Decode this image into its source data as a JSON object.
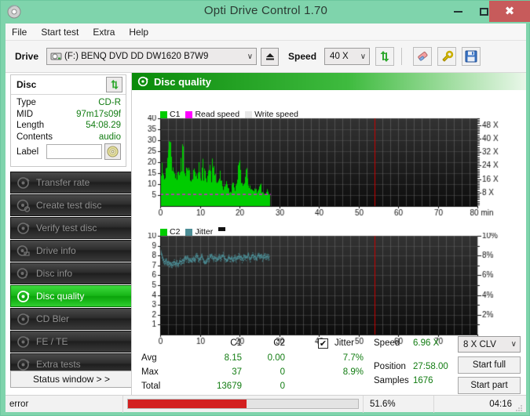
{
  "window": {
    "title": "Opti Drive Control 1.70",
    "icon": "disc-icon",
    "minimize_label": "–",
    "maximize_label": "□",
    "close_label": "×"
  },
  "menu": {
    "items": [
      "File",
      "Start test",
      "Extra",
      "Help"
    ]
  },
  "toolbar": {
    "drive_label": "Drive",
    "drive_value": "(F:)   BENQ DVD DD DW1620 B7W9",
    "eject_icon": "eject-icon",
    "speed_label": "Speed",
    "speed_value": "40 X",
    "refresh_icon": "refresh-icon",
    "eraser_icon": "eraser-icon",
    "tools_icon": "wrench-icon",
    "save_icon": "save-floppy-icon",
    "dropdown_arrow": "∨"
  },
  "disc": {
    "header": "Disc",
    "refresh_icon": "refresh-icon",
    "rows": [
      {
        "key": "Type",
        "value": "CD-R"
      },
      {
        "key": "MID",
        "value": "97m17s09f"
      },
      {
        "key": "Length",
        "value": "54:08.29"
      },
      {
        "key": "Contents",
        "value": "audio"
      }
    ],
    "label_key": "Label",
    "label_value": "",
    "label_placeholder": "",
    "label_icon": "cd-disc-icon"
  },
  "sidebar": {
    "items": [
      {
        "label": "Transfer rate",
        "icon": "disc-test-icon",
        "active": false
      },
      {
        "label": "Create test disc",
        "icon": "disc-create-icon",
        "active": false
      },
      {
        "label": "Verify test disc",
        "icon": "disc-verify-icon",
        "active": false
      },
      {
        "label": "Drive info",
        "icon": "disc-drive-icon",
        "active": false
      },
      {
        "label": "Disc info",
        "icon": "disc-info-icon",
        "active": false
      },
      {
        "label": "Disc quality",
        "icon": "disc-quality-icon",
        "active": true
      },
      {
        "label": "CD Bler",
        "icon": "disc-bler-icon",
        "active": false
      },
      {
        "label": "FE / TE",
        "icon": "disc-fete-icon",
        "active": false
      },
      {
        "label": "Extra tests",
        "icon": "disc-extra-icon",
        "active": false
      }
    ],
    "status_window_button": "Status window > >"
  },
  "panel": {
    "title": "Disc quality",
    "icon": "disc-quality-icon"
  },
  "stats": {
    "col_headers": [
      "C1",
      "C2"
    ],
    "jitter_header": "Jitter",
    "jitter_checked": true,
    "jitter_check_glyph": "✔",
    "rows": [
      {
        "name": "Avg",
        "c1": "8.15",
        "c2": "0.00",
        "jitter": "7.7%"
      },
      {
        "name": "Max",
        "c1": "37",
        "c2": "0",
        "jitter": "8.9%"
      },
      {
        "name": "Total",
        "c1": "13679",
        "c2": "0",
        "jitter": ""
      }
    ],
    "speed_label": "Speed",
    "speed_value": "6.96 X",
    "position_label": "Position",
    "position_value": "27:58.00",
    "samples_label": "Samples",
    "samples_value": "1676",
    "speed_select": "8 X CLV",
    "speed_select_arrow": "∨",
    "start_full": "Start full",
    "start_part": "Start part"
  },
  "statusbar": {
    "message": "error",
    "progress_percent": 51.6,
    "progress_text": "51.6%",
    "elapsed": "04:16"
  },
  "colors": {
    "accent_green": "#00c000",
    "title_bar": "#7fd4ac",
    "close_red": "#c75b5b",
    "c1_green": "#00cc00",
    "read_speed_magenta": "#ff00ff",
    "jitter_teal": "#4d8e96",
    "marker_red": "#cc0000",
    "progress_red": "#d32020",
    "plot_bg": "#1a1a1a"
  },
  "chart_data": [
    {
      "type": "bar",
      "title": "C1 errors / Read speed",
      "legend": [
        {
          "label": "C1",
          "color": "#00cc00"
        },
        {
          "label": "Read speed",
          "color": "#ff00ff"
        },
        {
          "label": "Write speed",
          "color": "#e8e8e8"
        }
      ],
      "legend_position": "top-left",
      "xlabel": "min",
      "ylabel": "",
      "y2label": "X",
      "xlim": [
        0,
        80
      ],
      "ylim": [
        0,
        40
      ],
      "y2lim": [
        0,
        52
      ],
      "xticks": [
        0,
        10,
        20,
        30,
        40,
        50,
        60,
        70,
        80
      ],
      "xticklabels": [
        "0",
        "10",
        "20",
        "30",
        "40",
        "50",
        "60",
        "70",
        "80 min"
      ],
      "yticks": [
        5,
        10,
        15,
        20,
        25,
        30,
        35,
        40
      ],
      "y2ticks": [
        8,
        16,
        24,
        32,
        40,
        48
      ],
      "y2ticklabels": [
        "8 X",
        "16 X",
        "24 X",
        "32 X",
        "40 X",
        "48 X"
      ],
      "grid": true,
      "data_end_x": 27.9,
      "marker_line_x": 54.1,
      "read_speed_value": 5.3,
      "series": [
        {
          "name": "C1",
          "color": "#00cc00",
          "x": [
            0.0,
            0.4,
            0.8,
            1.2,
            1.6,
            2.0,
            2.4,
            2.8,
            3.2,
            3.6,
            4.0,
            4.4,
            4.8,
            5.2,
            5.6,
            6.0,
            6.4,
            6.8,
            7.2,
            7.6,
            8.0,
            8.4,
            8.8,
            9.2,
            9.6,
            10.0,
            10.4,
            10.8,
            11.2,
            11.6,
            12.0,
            12.4,
            12.8,
            13.2,
            13.6,
            14.0,
            14.4,
            14.8,
            15.2,
            15.6,
            16.0,
            16.4,
            16.8,
            17.2,
            17.6,
            18.0,
            18.4,
            18.8,
            19.2,
            19.6,
            20.0,
            20.4,
            20.8,
            21.2,
            21.6,
            22.0,
            22.4,
            22.8,
            23.2,
            23.6,
            24.0,
            24.4,
            24.8,
            25.2,
            25.6,
            26.0,
            26.4,
            26.8,
            27.2,
            27.6
          ],
          "values": [
            32,
            18,
            15,
            16,
            21,
            27,
            37,
            24,
            16,
            18,
            13,
            17,
            15,
            22,
            32,
            20,
            14,
            28,
            17,
            13,
            12,
            19,
            16,
            14,
            22,
            14,
            12,
            25,
            18,
            11,
            15,
            23,
            14,
            28,
            20,
            13,
            11,
            12,
            17,
            10,
            9,
            10,
            13,
            8,
            7,
            9,
            12,
            8,
            13,
            18,
            23,
            16,
            9,
            12,
            25,
            11,
            10,
            9,
            8,
            7,
            9,
            6,
            8,
            11,
            7,
            6,
            5,
            8,
            6,
            5
          ]
        },
        {
          "name": "Read speed",
          "color": "#ff00ff",
          "x": [
            0,
            27.9
          ],
          "values": [
            5.3,
            5.3
          ],
          "style": "dashed-line"
        }
      ]
    },
    {
      "type": "line",
      "title": "C2 errors / Jitter",
      "legend": [
        {
          "label": "C2",
          "color": "#00cc00"
        },
        {
          "label": "Jitter",
          "color": "#4d8e96"
        },
        {
          "label": "",
          "color": "#111111"
        }
      ],
      "legend_position": "top-left",
      "xlabel": "min",
      "ylabel": "",
      "y2label": "%",
      "xlim": [
        0,
        80
      ],
      "ylim": [
        0,
        10
      ],
      "y2lim": [
        0,
        10
      ],
      "xticks": [
        0,
        10,
        20,
        30,
        40,
        50,
        60,
        70,
        80
      ],
      "xticklabels": [
        "0",
        "10",
        "20",
        "30",
        "40",
        "50",
        "60",
        "70",
        "80 min"
      ],
      "yticks": [
        1,
        2,
        3,
        4,
        5,
        6,
        7,
        8,
        9,
        10
      ],
      "y2ticks": [
        2,
        4,
        6,
        8,
        10
      ],
      "y2ticklabels": [
        "2%",
        "4%",
        "6%",
        "8%",
        "10%"
      ],
      "grid": true,
      "data_end_x": 27.6,
      "marker_line_x": 54.1,
      "series": [
        {
          "name": "Jitter",
          "color": "#4d8e96",
          "x": [
            0.0,
            0.3,
            0.6,
            0.9,
            1.2,
            1.5,
            1.8,
            2.1,
            2.4,
            2.7,
            3.0,
            3.3,
            3.6,
            3.9,
            4.2,
            4.5,
            4.8,
            5.1,
            5.4,
            5.7,
            6.0,
            6.3,
            6.6,
            6.9,
            7.2,
            7.5,
            7.8,
            8.1,
            8.4,
            8.7,
            9.0,
            9.3,
            9.6,
            9.9,
            10.2,
            10.5,
            10.8,
            11.1,
            11.4,
            11.7,
            12.0,
            12.3,
            12.6,
            12.9,
            13.2,
            13.5,
            13.8,
            14.1,
            14.4,
            14.7,
            15.0,
            15.3,
            15.6,
            15.9,
            16.2,
            16.5,
            16.8,
            17.1,
            17.4,
            17.7,
            18.0,
            18.3,
            18.6,
            18.9,
            19.2,
            19.5,
            19.8,
            20.1,
            20.4,
            20.7,
            21.0,
            21.3,
            21.6,
            21.9,
            22.2,
            22.5,
            22.8,
            23.1,
            23.4,
            23.7,
            24.0,
            24.3,
            24.6,
            24.9,
            25.2,
            25.5,
            25.8,
            26.1,
            26.4,
            26.7,
            27.0,
            27.3,
            27.6
          ],
          "values": [
            8.9,
            8.2,
            7.8,
            7.5,
            7.3,
            7.6,
            7.2,
            7.4,
            7.1,
            7.3,
            7.0,
            7.2,
            7.4,
            7.1,
            7.3,
            7.0,
            7.2,
            7.5,
            7.3,
            7.6,
            7.4,
            7.9,
            7.6,
            7.8,
            7.5,
            7.7,
            7.4,
            7.6,
            7.8,
            7.5,
            7.9,
            8.1,
            7.7,
            7.5,
            7.8,
            8.0,
            7.6,
            7.4,
            7.2,
            7.5,
            7.8,
            7.6,
            7.9,
            8.1,
            7.8,
            7.6,
            7.9,
            7.7,
            7.5,
            7.8,
            8.0,
            7.7,
            7.9,
            8.1,
            7.8,
            7.6,
            7.4,
            7.7,
            7.9,
            7.6,
            7.8,
            7.5,
            7.7,
            7.9,
            7.6,
            7.8,
            8.0,
            7.7,
            7.9,
            7.6,
            7.8,
            8.0,
            7.7,
            7.9,
            8.1,
            7.8,
            7.6,
            7.9,
            8.1,
            7.8,
            8.0,
            7.7,
            7.9,
            8.1,
            7.8,
            8.0,
            7.7,
            7.9,
            8.1,
            7.8,
            8.0,
            7.8,
            7.9
          ]
        },
        {
          "name": "C2",
          "color": "#00cc00",
          "x": [],
          "values": []
        }
      ]
    }
  ]
}
